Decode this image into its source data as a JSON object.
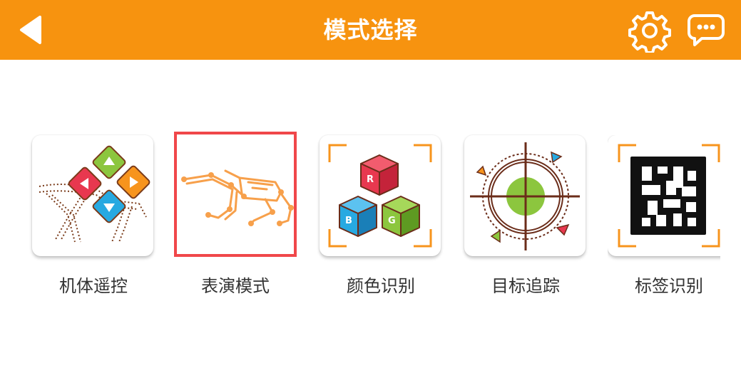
{
  "header": {
    "title": "模式选择",
    "accent_color": "#f7930f",
    "back_icon": "back-arrow-icon",
    "settings_icon": "gear-icon",
    "feedback_icon": "chat-bubble-icon"
  },
  "modes": [
    {
      "label": "机体遥控",
      "icon": "remote-control-icon",
      "selected": false
    },
    {
      "label": "表演模式",
      "icon": "robot-dog-icon",
      "selected": true
    },
    {
      "label": "颜色识别",
      "icon": "rgb-cubes-icon",
      "selected": false
    },
    {
      "label": "目标追踪",
      "icon": "crosshair-target-icon",
      "selected": false
    },
    {
      "label": "标签识别",
      "icon": "qr-tag-icon",
      "selected": false
    }
  ],
  "selection_color": "#f0474a"
}
